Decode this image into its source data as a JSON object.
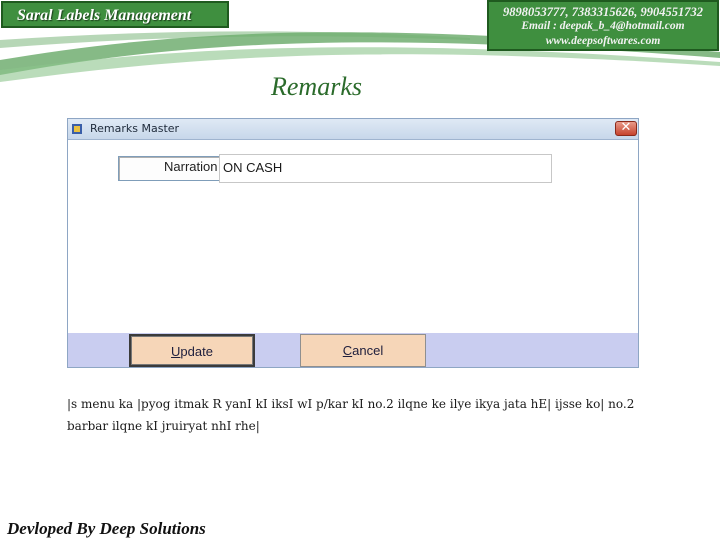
{
  "header": {
    "app_title": "Saral Labels Management",
    "contact": {
      "phones": "9898053777, 7383315626, 9904551732",
      "email": "Email : deepak_b_4@hotmail.com",
      "website": "www.deepsoftwares.com"
    }
  },
  "page": {
    "title": "Remarks"
  },
  "window": {
    "title": "Remarks Master",
    "close_symbol": "✕",
    "field": {
      "label": "Narration",
      "value": "ON CASH"
    },
    "buttons": {
      "update": {
        "accel": "U",
        "rest": "pdate"
      },
      "cancel": {
        "accel": "C",
        "rest": "ancel"
      }
    }
  },
  "description": "|s menu ka |pyog itmak R yanI kI iksI wI p/kar kI no.2 ilqne ke ilye ikya jata hE| ijsse ko| no.2 barbar ilqne kI jruiryat nhI rhe|",
  "footer": {
    "text": "Devloped By Deep Solutions"
  },
  "colors": {
    "brand_green": "#3f8f3f",
    "button_fill": "#f6d6b8",
    "button_panel": "#c9cdf0"
  }
}
